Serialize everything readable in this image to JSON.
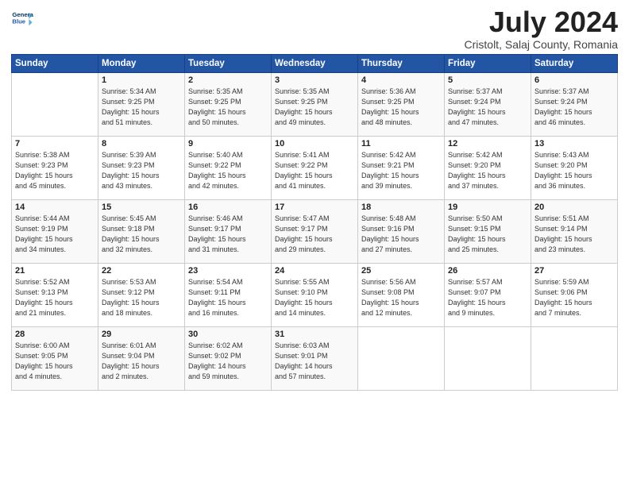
{
  "header": {
    "title": "July 2024",
    "subtitle": "Cristolt, Salaj County, Romania",
    "logo_line1": "General",
    "logo_line2": "Blue"
  },
  "weekdays": [
    "Sunday",
    "Monday",
    "Tuesday",
    "Wednesday",
    "Thursday",
    "Friday",
    "Saturday"
  ],
  "weeks": [
    [
      {
        "day": "",
        "info": ""
      },
      {
        "day": "1",
        "info": "Sunrise: 5:34 AM\nSunset: 9:25 PM\nDaylight: 15 hours\nand 51 minutes."
      },
      {
        "day": "2",
        "info": "Sunrise: 5:35 AM\nSunset: 9:25 PM\nDaylight: 15 hours\nand 50 minutes."
      },
      {
        "day": "3",
        "info": "Sunrise: 5:35 AM\nSunset: 9:25 PM\nDaylight: 15 hours\nand 49 minutes."
      },
      {
        "day": "4",
        "info": "Sunrise: 5:36 AM\nSunset: 9:25 PM\nDaylight: 15 hours\nand 48 minutes."
      },
      {
        "day": "5",
        "info": "Sunrise: 5:37 AM\nSunset: 9:24 PM\nDaylight: 15 hours\nand 47 minutes."
      },
      {
        "day": "6",
        "info": "Sunrise: 5:37 AM\nSunset: 9:24 PM\nDaylight: 15 hours\nand 46 minutes."
      }
    ],
    [
      {
        "day": "7",
        "info": "Sunrise: 5:38 AM\nSunset: 9:23 PM\nDaylight: 15 hours\nand 45 minutes."
      },
      {
        "day": "8",
        "info": "Sunrise: 5:39 AM\nSunset: 9:23 PM\nDaylight: 15 hours\nand 43 minutes."
      },
      {
        "day": "9",
        "info": "Sunrise: 5:40 AM\nSunset: 9:22 PM\nDaylight: 15 hours\nand 42 minutes."
      },
      {
        "day": "10",
        "info": "Sunrise: 5:41 AM\nSunset: 9:22 PM\nDaylight: 15 hours\nand 41 minutes."
      },
      {
        "day": "11",
        "info": "Sunrise: 5:42 AM\nSunset: 9:21 PM\nDaylight: 15 hours\nand 39 minutes."
      },
      {
        "day": "12",
        "info": "Sunrise: 5:42 AM\nSunset: 9:20 PM\nDaylight: 15 hours\nand 37 minutes."
      },
      {
        "day": "13",
        "info": "Sunrise: 5:43 AM\nSunset: 9:20 PM\nDaylight: 15 hours\nand 36 minutes."
      }
    ],
    [
      {
        "day": "14",
        "info": "Sunrise: 5:44 AM\nSunset: 9:19 PM\nDaylight: 15 hours\nand 34 minutes."
      },
      {
        "day": "15",
        "info": "Sunrise: 5:45 AM\nSunset: 9:18 PM\nDaylight: 15 hours\nand 32 minutes."
      },
      {
        "day": "16",
        "info": "Sunrise: 5:46 AM\nSunset: 9:17 PM\nDaylight: 15 hours\nand 31 minutes."
      },
      {
        "day": "17",
        "info": "Sunrise: 5:47 AM\nSunset: 9:17 PM\nDaylight: 15 hours\nand 29 minutes."
      },
      {
        "day": "18",
        "info": "Sunrise: 5:48 AM\nSunset: 9:16 PM\nDaylight: 15 hours\nand 27 minutes."
      },
      {
        "day": "19",
        "info": "Sunrise: 5:50 AM\nSunset: 9:15 PM\nDaylight: 15 hours\nand 25 minutes."
      },
      {
        "day": "20",
        "info": "Sunrise: 5:51 AM\nSunset: 9:14 PM\nDaylight: 15 hours\nand 23 minutes."
      }
    ],
    [
      {
        "day": "21",
        "info": "Sunrise: 5:52 AM\nSunset: 9:13 PM\nDaylight: 15 hours\nand 21 minutes."
      },
      {
        "day": "22",
        "info": "Sunrise: 5:53 AM\nSunset: 9:12 PM\nDaylight: 15 hours\nand 18 minutes."
      },
      {
        "day": "23",
        "info": "Sunrise: 5:54 AM\nSunset: 9:11 PM\nDaylight: 15 hours\nand 16 minutes."
      },
      {
        "day": "24",
        "info": "Sunrise: 5:55 AM\nSunset: 9:10 PM\nDaylight: 15 hours\nand 14 minutes."
      },
      {
        "day": "25",
        "info": "Sunrise: 5:56 AM\nSunset: 9:08 PM\nDaylight: 15 hours\nand 12 minutes."
      },
      {
        "day": "26",
        "info": "Sunrise: 5:57 AM\nSunset: 9:07 PM\nDaylight: 15 hours\nand 9 minutes."
      },
      {
        "day": "27",
        "info": "Sunrise: 5:59 AM\nSunset: 9:06 PM\nDaylight: 15 hours\nand 7 minutes."
      }
    ],
    [
      {
        "day": "28",
        "info": "Sunrise: 6:00 AM\nSunset: 9:05 PM\nDaylight: 15 hours\nand 4 minutes."
      },
      {
        "day": "29",
        "info": "Sunrise: 6:01 AM\nSunset: 9:04 PM\nDaylight: 15 hours\nand 2 minutes."
      },
      {
        "day": "30",
        "info": "Sunrise: 6:02 AM\nSunset: 9:02 PM\nDaylight: 14 hours\nand 59 minutes."
      },
      {
        "day": "31",
        "info": "Sunrise: 6:03 AM\nSunset: 9:01 PM\nDaylight: 14 hours\nand 57 minutes."
      },
      {
        "day": "",
        "info": ""
      },
      {
        "day": "",
        "info": ""
      },
      {
        "day": "",
        "info": ""
      }
    ]
  ]
}
